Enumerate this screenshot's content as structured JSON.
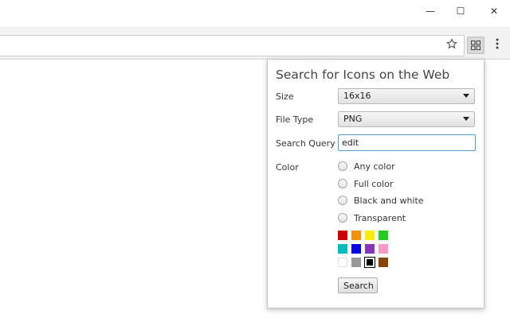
{
  "window_controls": {
    "minimize": "—",
    "maximize": "☐",
    "close": "✕"
  },
  "toolbar": {
    "star_icon": "star-icon",
    "extension_icon": "grid-icon",
    "menu_icon": "kebab-menu-icon"
  },
  "popup": {
    "title": "Search for Icons on the Web",
    "size": {
      "label": "Size",
      "value": "16x16"
    },
    "file_type": {
      "label": "File Type",
      "value": "PNG"
    },
    "search_query": {
      "label": "Search Query",
      "value": "edit"
    },
    "color": {
      "label": "Color",
      "options": [
        "Any color",
        "Full color",
        "Black and white",
        "Transparent"
      ],
      "swatches": [
        "#cc0000",
        "#f59200",
        "#ffee00",
        "#22cc22",
        "#00bbbb",
        "#0000ee",
        "#8833bb",
        "#ff99cc",
        "#ffffff",
        "#999999",
        "#000000",
        "#884400"
      ],
      "selected_swatch": "#000000"
    },
    "search_button": "Search"
  }
}
